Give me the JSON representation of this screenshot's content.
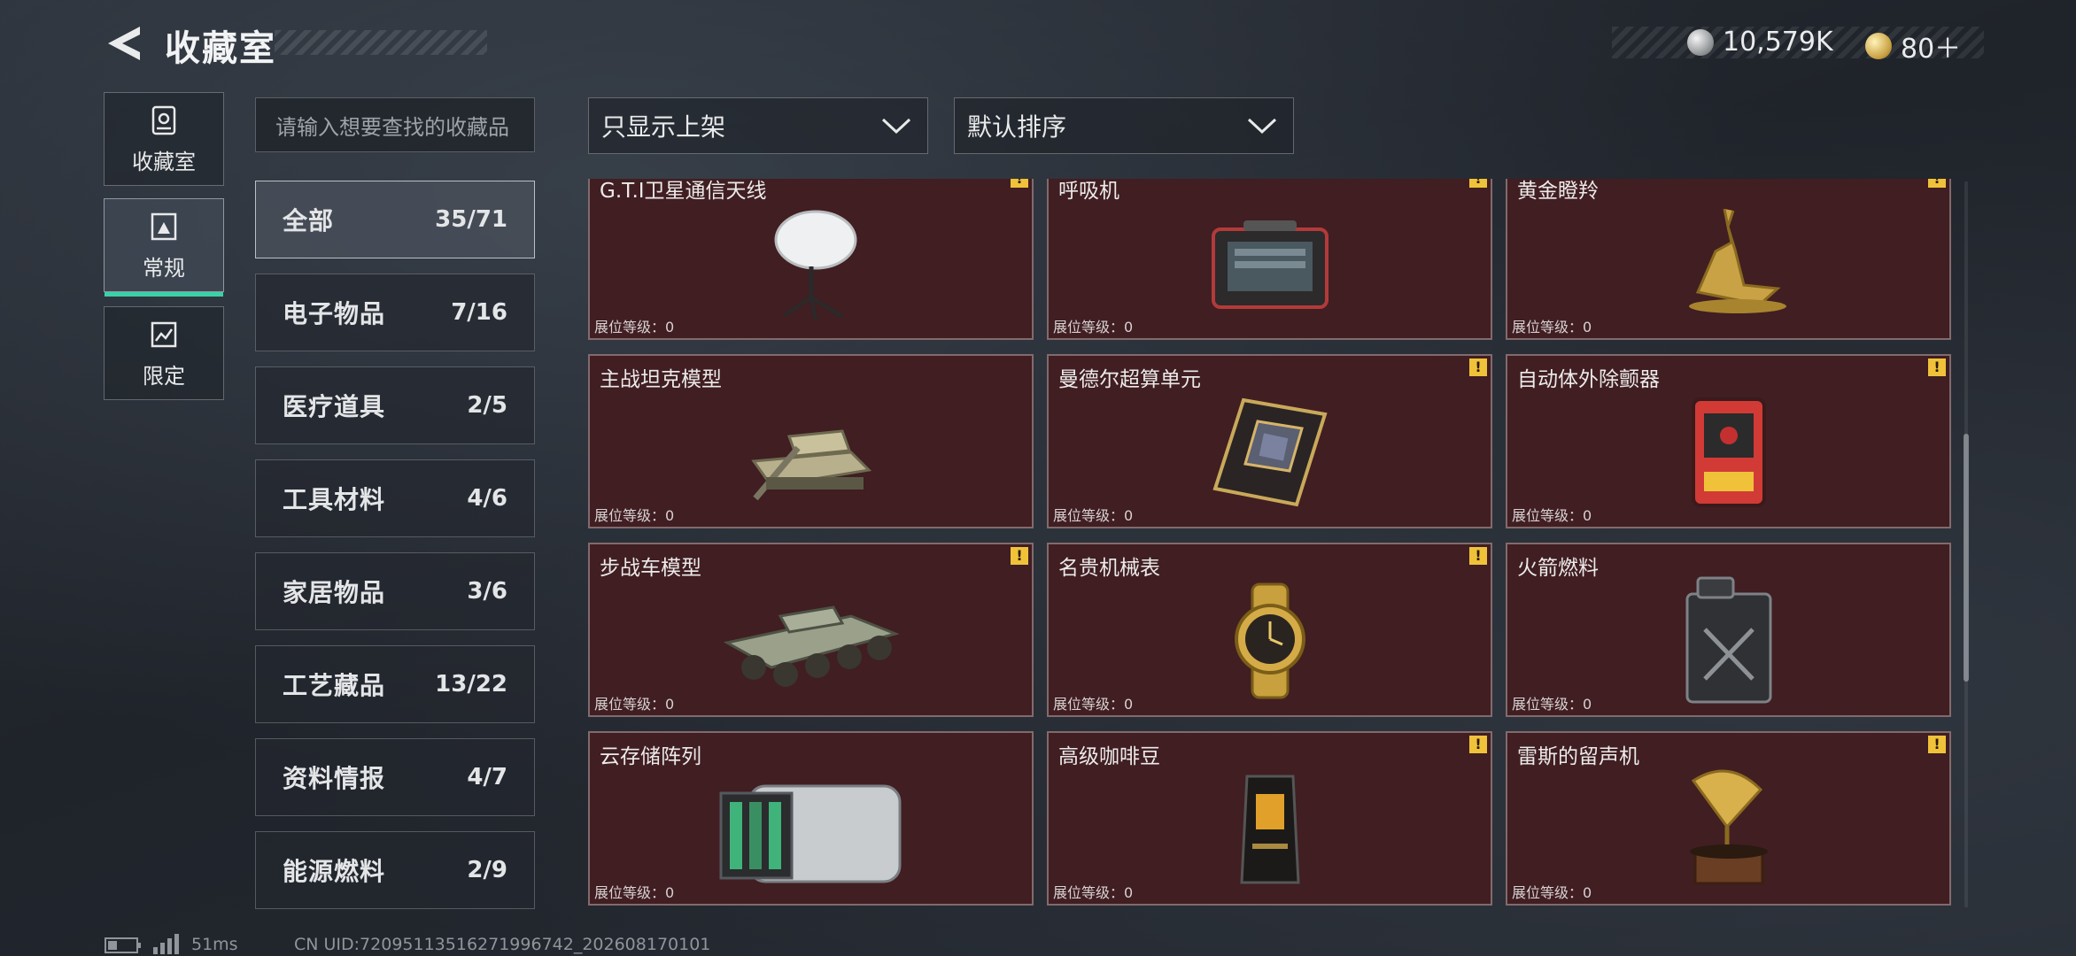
{
  "header": {
    "title": "收藏室",
    "currency_silver": "10,579K",
    "currency_gold": "80＋"
  },
  "nav": [
    {
      "label": "收藏室",
      "icon": "collection-room-icon"
    },
    {
      "label": "常规",
      "icon": "regular-icon"
    },
    {
      "label": "限定",
      "icon": "limited-icon"
    }
  ],
  "search": {
    "placeholder": "请输入想要查找的收藏品"
  },
  "filters": {
    "availability": "只显示上架",
    "sort": "默认排序"
  },
  "categories": [
    {
      "name": "全部",
      "count": "35/71"
    },
    {
      "name": "电子物品",
      "count": "7/16"
    },
    {
      "name": "医疗道具",
      "count": "2/5"
    },
    {
      "name": "工具材料",
      "count": "4/6"
    },
    {
      "name": "家居物品",
      "count": "3/6"
    },
    {
      "name": "工艺藏品",
      "count": "13/22"
    },
    {
      "name": "资料情报",
      "count": "4/7"
    },
    {
      "name": "能源燃料",
      "count": "2/9"
    }
  ],
  "items": [
    {
      "name": "G.T.I卫星通信天线",
      "level": "展位等级：0",
      "warn": true
    },
    {
      "name": "呼吸机",
      "level": "展位等级：0",
      "warn": true
    },
    {
      "name": "黄金瞪羚",
      "level": "展位等级：0",
      "warn": true
    },
    {
      "name": "主战坦克模型",
      "level": "展位等级：0",
      "warn": false
    },
    {
      "name": "曼德尔超算单元",
      "level": "展位等级：0",
      "warn": true
    },
    {
      "name": "自动体外除颤器",
      "level": "展位等级：0",
      "warn": true
    },
    {
      "name": "步战车模型",
      "level": "展位等级：0",
      "warn": true
    },
    {
      "name": "名贵机械表",
      "level": "展位等级：0",
      "warn": true
    },
    {
      "name": "火箭燃料",
      "level": "展位等级：0",
      "warn": false
    },
    {
      "name": "云存储阵列",
      "level": "展位等级：0",
      "warn": false
    },
    {
      "name": "高级咖啡豆",
      "level": "展位等级：0",
      "warn": true
    },
    {
      "name": "雷斯的留声机",
      "level": "展位等级：0",
      "warn": true
    }
  ],
  "footer": {
    "ping": "51ms",
    "uid": "CN UID:72095113516271996742_202608170101"
  },
  "colors": {
    "accent": "#3ad0a8",
    "card_bg": "#401e22",
    "warning": "#f0c23a"
  }
}
